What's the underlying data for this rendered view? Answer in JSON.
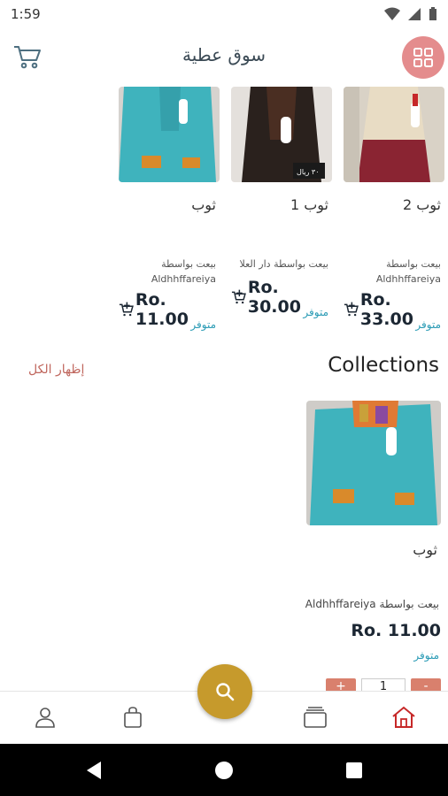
{
  "status_bar": {
    "time": "1:59"
  },
  "app_bar": {
    "title": "سوق عطية"
  },
  "products": [
    {
      "name": "ثوب 2",
      "seller_prefix": "بيعت بواسطة",
      "seller_name": "Aldhhffareiya",
      "price": "Ro. 33.00",
      "stock": "متوفر"
    },
    {
      "name": "ثوب 1",
      "seller_prefix": "بيعت بواسطة دار العلا",
      "seller_name": "",
      "price": "Ro. 30.00",
      "stock": "متوفر"
    },
    {
      "name": "ثوب",
      "seller_prefix": "بيعت بواسطة",
      "seller_name": "Aldhhffareiya",
      "price": "Ro. 11.00",
      "stock": "متوفر"
    }
  ],
  "collections": {
    "title": "Collections",
    "show_all": "إظهار الكل",
    "item": {
      "name": "ثوب",
      "seller": "بيعت بواسطة Aldhhffareiya",
      "price": "Ro. 11.00",
      "stock": "متوفر",
      "quantity": "1",
      "minus_label": "-",
      "plus_label": "+"
    }
  },
  "bottom_nav": {
    "items": [
      "home-icon",
      "collections-icon",
      "bag-icon",
      "profile-icon"
    ],
    "fab_icon": "search-icon"
  },
  "colors": {
    "accent_pink": "#e48c8d",
    "accent_gold": "#c69a2c",
    "stock_teal": "#2a9bb5",
    "home_red": "#c62828",
    "qty_button": "#d9806d"
  }
}
